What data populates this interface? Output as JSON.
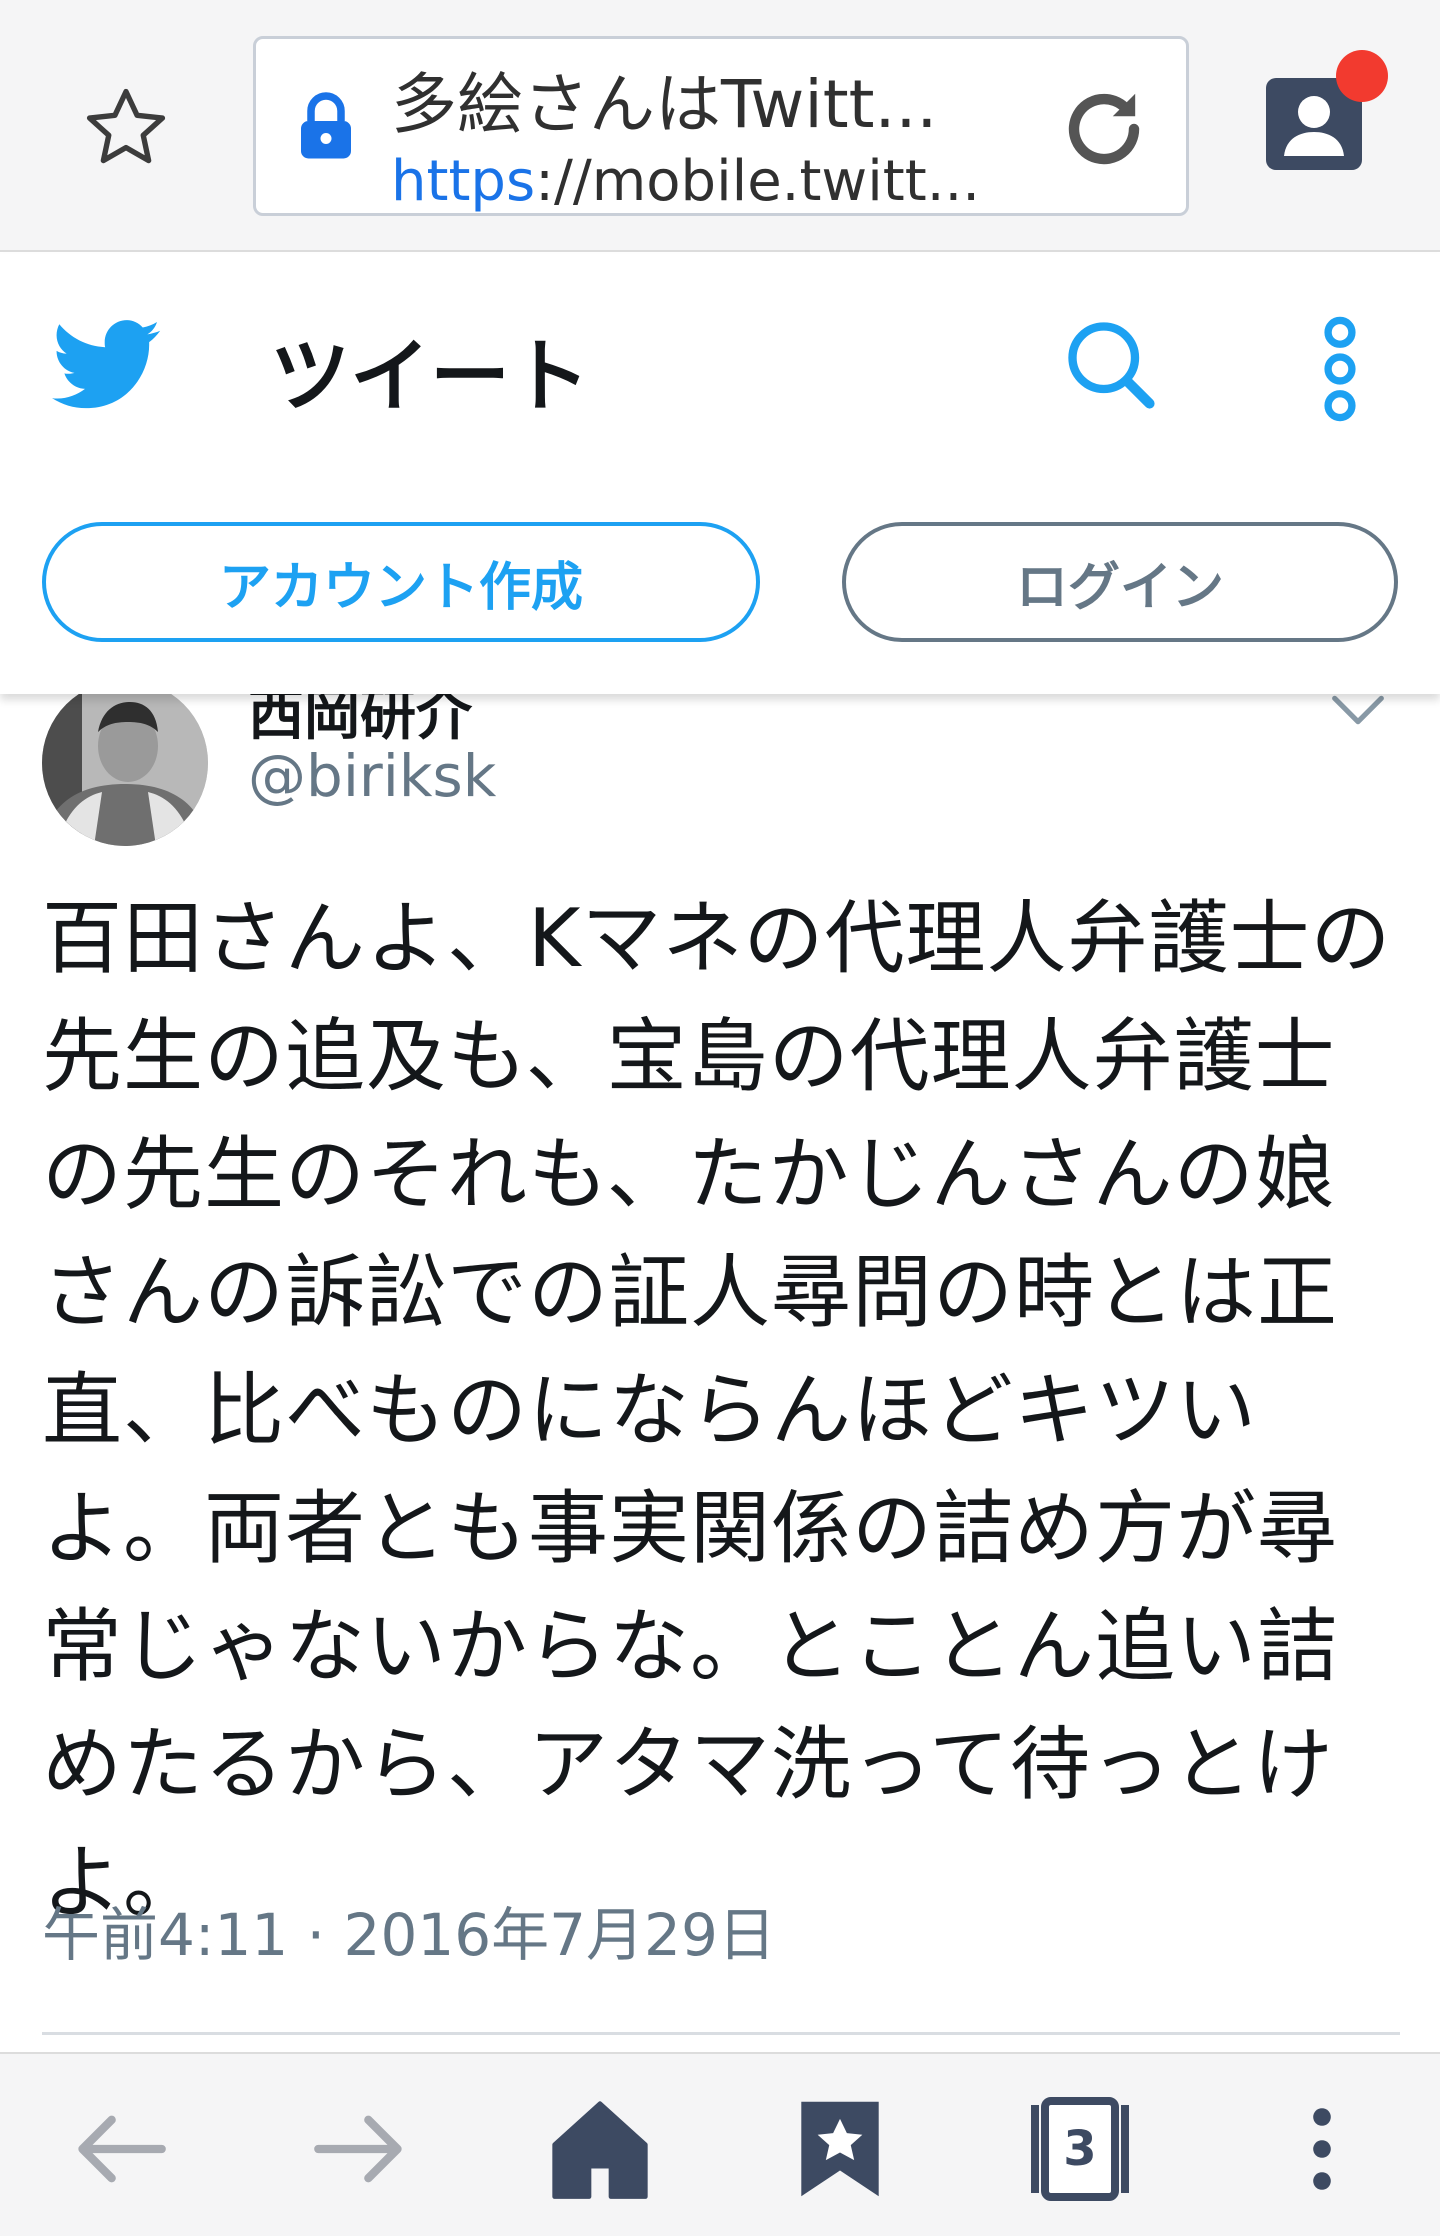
{
  "browser": {
    "tab_title": "多絵さんはTwitt...",
    "url_scheme": "https",
    "url_rest": "://mobile.twitt...",
    "tab_count": "3"
  },
  "twitter": {
    "header_title": "ツイート",
    "signup_label": "アカウント作成",
    "login_label": "ログイン",
    "brand_color": "#1da1f2"
  },
  "tweet": {
    "author_name": "西岡研介",
    "author_handle": "@biriksk",
    "text": "百田さんよ、Kマネの代理人弁護士の先生の追及も、宝島の代理人弁護士の先生のそれも、たかじんさんの娘さんの訴訟での証人尋問の時とは正直、比べものにならんほどキツいよ。両者とも事実関係の詰め方が尋常じゃないからな。とことん追い詰めたるから、アタマ洗って待っとけよ。",
    "timestamp": "午前4:11 · 2016年7月29日"
  }
}
